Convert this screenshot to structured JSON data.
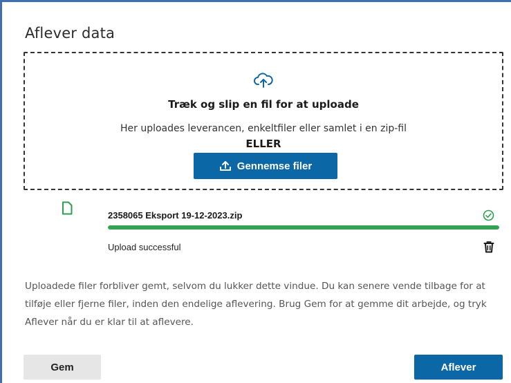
{
  "dialog": {
    "title": "Aflever data"
  },
  "dropzone": {
    "icon": "cloud-upload-icon",
    "heading": "Træk og slip en fil for at uploade",
    "subtext": "Her uploades leverancen, enkeltfiler eller samlet i en zip-fil",
    "or_label": "ELLER",
    "browse_label": "Gennemse filer",
    "browse_icon": "upload-icon"
  },
  "file": {
    "icon": "file-icon",
    "name": "2358065 Eksport 19-12-2023.zip",
    "status_icon": "check-circle-icon",
    "progress_percent": 100,
    "status": "Upload successful",
    "delete_icon": "trash-icon"
  },
  "info_text": "Uploadede filer forbliver gemt, selvom du lukker dette vindue. Du kan senere vende tilbage for at tilføje eller fjerne filer, inden den endelige aflevering. Brug Gem for at gemme dit arbejde, og tryk Aflever når du er klar til at aflevere.",
  "actions": {
    "save_label": "Gem",
    "submit_label": "Aflever"
  },
  "colors": {
    "primary": "#0b67a6",
    "success": "#33a353",
    "frame": "#3f6fb3"
  }
}
